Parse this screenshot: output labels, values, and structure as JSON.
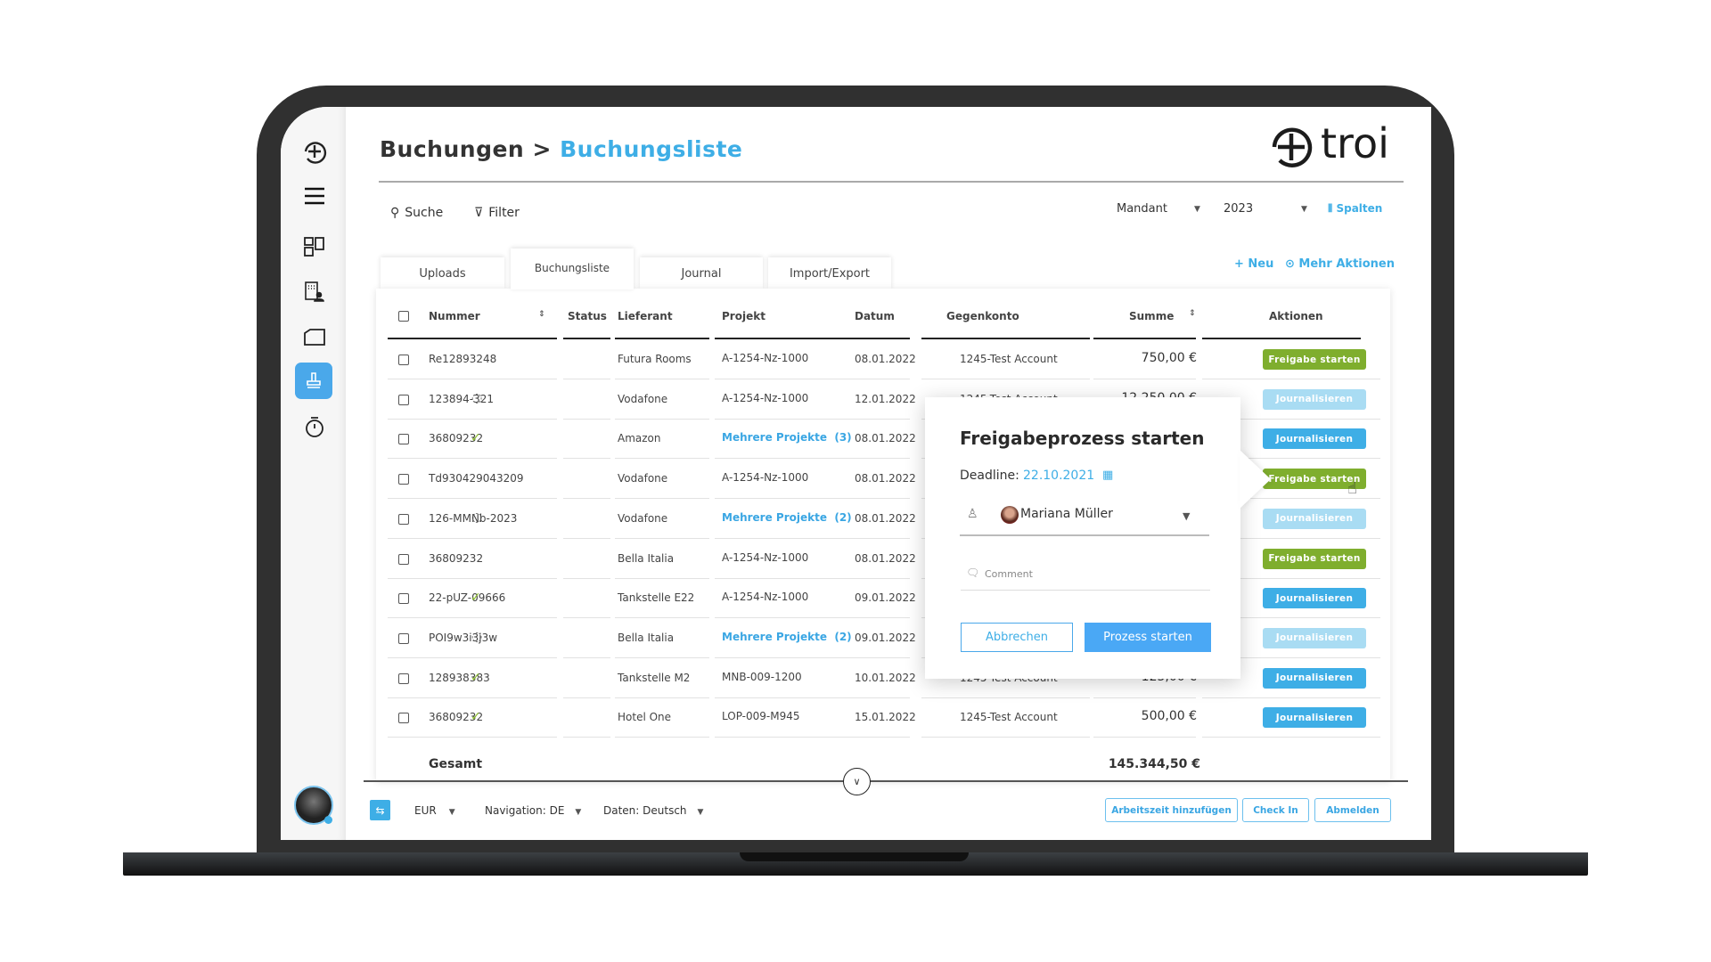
{
  "header": {
    "breadcrumb_parent": "Buchungen",
    "separator": ">",
    "breadcrumb_current": "Buchungsliste",
    "logo_text": "troi"
  },
  "toolbar": {
    "search": "Suche",
    "filter": "Filter",
    "mandant": "Mandant",
    "year": "2023",
    "columns": "Spalten",
    "new": "+ Neu",
    "more_actions": "Mehr Aktionen"
  },
  "tabs": [
    {
      "label": "Uploads"
    },
    {
      "label": "Buchungsliste",
      "active": true
    },
    {
      "label": "Journal"
    },
    {
      "label": "Import/Export"
    }
  ],
  "table": {
    "columns": {
      "nummer": "Nummer",
      "status": "Status",
      "lieferant": "Lieferant",
      "projekt": "Projekt",
      "datum": "Datum",
      "gegenkonto": "Gegenkonto",
      "summe": "Summe",
      "aktionen": "Aktionen"
    },
    "rows": [
      {
        "nummer": "Re12893248",
        "status": "",
        "lieferant": "Futura Rooms",
        "projekt": "A-1254-Nz-1000",
        "projekt_link": false,
        "datum": "08.01.2022",
        "gegenkonto": "1245-Test Account",
        "summe": "750,00 €",
        "action": "Freigabe starten",
        "action_style": "green"
      },
      {
        "nummer": "123894-321",
        "status": "pending",
        "lieferant": "Vodafone",
        "projekt": "A-1254-Nz-1000",
        "projekt_link": false,
        "datum": "12.01.2022",
        "gegenkonto": "1245-Test Account",
        "summe": "12.250,00 €",
        "action": "Journalisieren",
        "action_style": "light"
      },
      {
        "nummer": "36809232",
        "status": "done",
        "lieferant": "Amazon",
        "projekt": "Mehrere Projekte  (3)",
        "projekt_link": true,
        "datum": "08.01.2022",
        "gegenkonto": "",
        "summe": "",
        "action": "Journalisieren",
        "action_style": "blue"
      },
      {
        "nummer": "Td930429043209",
        "status": "",
        "lieferant": "Vodafone",
        "projekt": "A-1254-Nz-1000",
        "projekt_link": false,
        "datum": "08.01.2022",
        "gegenkonto": "",
        "summe": "",
        "action": "Freigabe starten",
        "action_style": "green"
      },
      {
        "nummer": "126-MMNb-2023",
        "status": "pending",
        "lieferant": "Vodafone",
        "projekt": "Mehrere Projekte  (2)",
        "projekt_link": true,
        "datum": "08.01.2022",
        "gegenkonto": "",
        "summe": "",
        "action": "Journalisieren",
        "action_style": "light"
      },
      {
        "nummer": "36809232",
        "status": "",
        "lieferant": "Bella Italia",
        "projekt": "A-1254-Nz-1000",
        "projekt_link": false,
        "datum": "08.01.2022",
        "gegenkonto": "",
        "summe": "",
        "action": "Freigabe starten",
        "action_style": "green"
      },
      {
        "nummer": "22-pUZ-09666",
        "status": "done",
        "lieferant": "Tankstelle E22",
        "projekt": "A-1254-Nz-1000",
        "projekt_link": false,
        "datum": "09.01.2022",
        "gegenkonto": "",
        "summe": "",
        "action": "Journalisieren",
        "action_style": "blue"
      },
      {
        "nummer": "POI9w3i3j3w",
        "status": "pending",
        "lieferant": "Bella Italia",
        "projekt": "Mehrere Projekte  (2)",
        "projekt_link": true,
        "datum": "09.01.2022",
        "gegenkonto": "",
        "summe": "",
        "action": "Journalisieren",
        "action_style": "light"
      },
      {
        "nummer": "128938383",
        "status": "done",
        "lieferant": "Tankstelle M2",
        "projekt": "MNB-009-1200",
        "projekt_link": false,
        "datum": "10.01.2022",
        "gegenkonto": "1245-Test Account",
        "summe": "125,00 €",
        "action": "Journalisieren",
        "action_style": "blue"
      },
      {
        "nummer": "36809232",
        "status": "done",
        "lieferant": "Hotel One",
        "projekt": "LOP-009-M945",
        "projekt_link": false,
        "datum": "15.01.2022",
        "gegenkonto": "1245-Test Account",
        "summe": "500,00 €",
        "action": "Journalisieren",
        "action_style": "blue"
      }
    ],
    "total_label": "Gesamt",
    "total_value": "145.344,50 €"
  },
  "popup": {
    "title": "Freigabeprozess starten",
    "deadline_label": "Deadline:",
    "deadline_value": "22.10.2021",
    "assignee": "Mariana Müller",
    "comment_placeholder": "Comment",
    "cancel": "Abbrechen",
    "submit": "Prozess starten"
  },
  "footer": {
    "currency": "EUR",
    "navigation": "Navigation: DE",
    "data_lang": "Daten: Deutsch",
    "add_time": "Arbeitszeit hinzufügen",
    "check_in": "Check In",
    "logout": "Abmelden"
  },
  "colors": {
    "accent": "#3eaee6",
    "green": "#7fae2e",
    "disabled": "#a9dcf3",
    "frame": "#303030"
  }
}
